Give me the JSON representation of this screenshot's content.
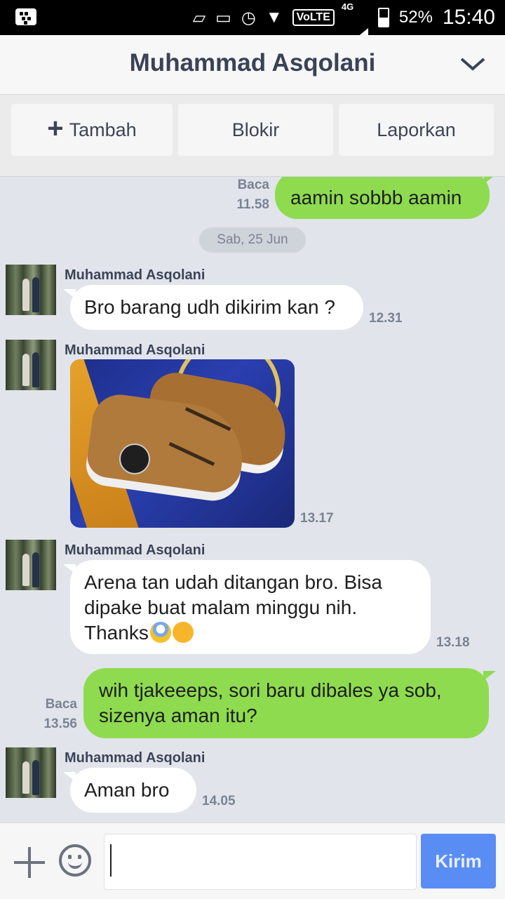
{
  "status_bar": {
    "battery": "52%",
    "time": "15:40",
    "network": "4G",
    "volte": "VoLTE"
  },
  "header": {
    "title": "Muhammad Asqolani"
  },
  "actions": {
    "add_label": "Tambah",
    "block_label": "Blokir",
    "report_label": "Laporkan"
  },
  "chat": {
    "date_separator": "Sab, 25 Jun",
    "messages": [
      {
        "direction": "out",
        "text": "aamin sobbb aamin",
        "read": "Baca",
        "time": "11.58"
      },
      {
        "direction": "in",
        "sender": "Muhammad Asqolani",
        "text": "Bro barang udh dikirim kan ?",
        "time": "12.31"
      },
      {
        "direction": "in",
        "sender": "Muhammad Asqolani",
        "type": "photo",
        "time": "13.17"
      },
      {
        "direction": "in",
        "sender": "Muhammad Asqolani",
        "text_line1": "Arena tan udah ditangan bro. Bisa",
        "text_line2": "dipake buat malam minggu nih.",
        "text_line3": "Thanks",
        "time": "13.18"
      },
      {
        "direction": "out",
        "text_line1": "wih tjakeeeps, sori baru dibales ya sob,",
        "text_line2": "sizenya aman itu?",
        "read": "Baca",
        "time": "13.56"
      },
      {
        "direction": "in",
        "sender": "Muhammad Asqolani",
        "text": "Aman bro",
        "time": "14.05"
      }
    ]
  },
  "footer": {
    "input_value": "",
    "send_label": "Kirim"
  },
  "colors": {
    "outgoing_bubble": "#8edb50",
    "incoming_bubble": "#ffffff",
    "send_button": "#5a8df3",
    "chat_background": "#e1e4ea"
  }
}
